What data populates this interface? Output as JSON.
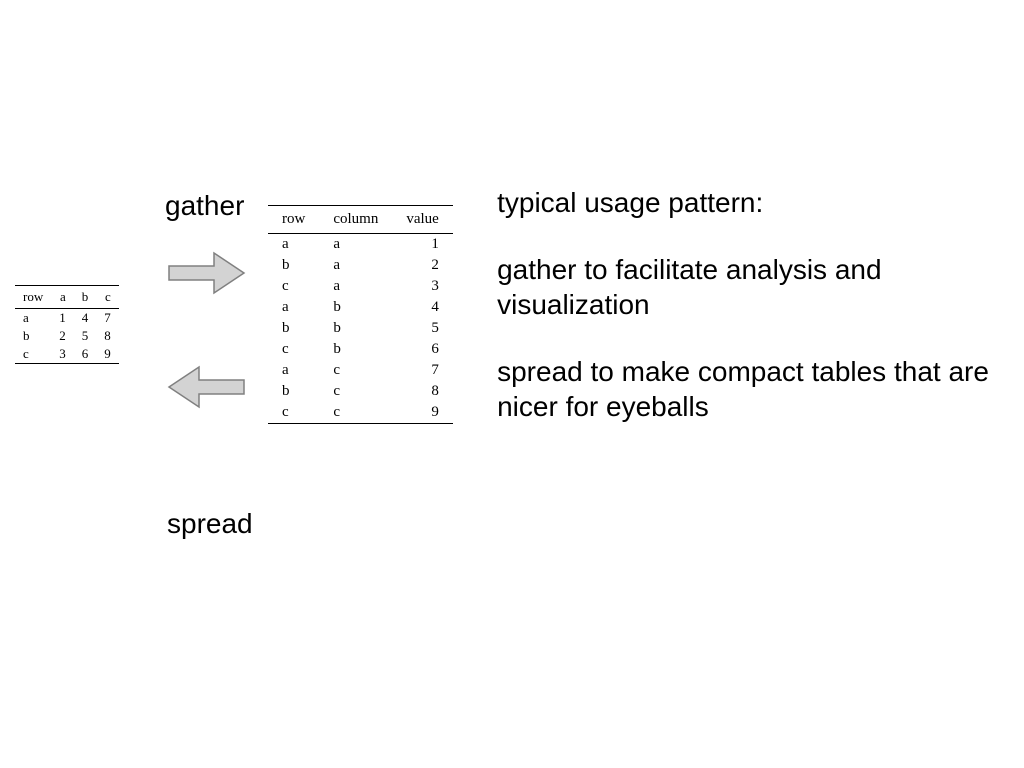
{
  "labels": {
    "gather": "gather",
    "spread": "spread"
  },
  "wideTable": {
    "headers": [
      "row",
      "a",
      "b",
      "c"
    ],
    "rows": [
      [
        "a",
        "1",
        "4",
        "7"
      ],
      [
        "b",
        "2",
        "5",
        "8"
      ],
      [
        "c",
        "3",
        "6",
        "9"
      ]
    ]
  },
  "longTable": {
    "headers": [
      "row",
      "column",
      "value"
    ],
    "rows": [
      [
        "a",
        "a",
        "1"
      ],
      [
        "b",
        "a",
        "2"
      ],
      [
        "c",
        "a",
        "3"
      ],
      [
        "a",
        "b",
        "4"
      ],
      [
        "b",
        "b",
        "5"
      ],
      [
        "c",
        "b",
        "6"
      ],
      [
        "a",
        "c",
        "7"
      ],
      [
        "b",
        "c",
        "8"
      ],
      [
        "c",
        "c",
        "9"
      ]
    ]
  },
  "description": {
    "p1": "typical usage pattern:",
    "p2": "gather to facilitate analysis and visualization",
    "p3": "spread to make compact tables that are nicer for eyeballs"
  }
}
